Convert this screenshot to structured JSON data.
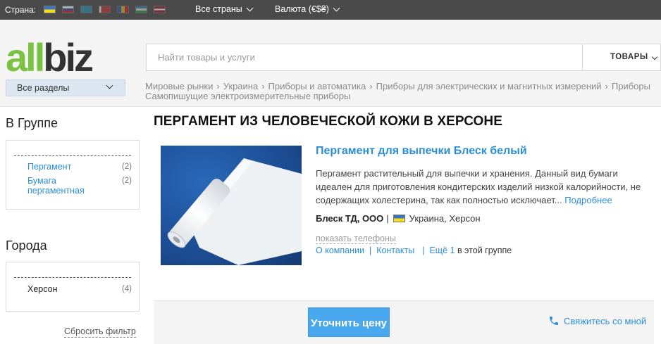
{
  "topbar": {
    "country_label": "Страна:",
    "flags": [
      "ukraine-flag-icon",
      "russia-flag-icon",
      "kazakhstan-flag-icon",
      "belarus-flag-icon",
      "moldova-flag-icon",
      "uzbekistan-flag-icon",
      "latvia-flag-icon"
    ],
    "all_countries": "Все страны",
    "currency": "Валюта (€$₴)"
  },
  "header": {
    "logo_part1": "all",
    "logo_part2": "biz",
    "sections_label": "Все разделы",
    "search_placeholder": "Найти товары и услуги",
    "search_type": "ТОВАРЫ",
    "breadcrumbs": [
      "Мировые рынки",
      "Украина",
      "Приборы и автоматика",
      "Приборы для электрических и магнитных измерений",
      "Приборы"
    ],
    "breadcrumb_last": "Самопишущие электроизмерительные приборы"
  },
  "sidebar": {
    "group_title": "В Группе",
    "group_items": [
      {
        "label": "Пергамент",
        "count": "(2)"
      },
      {
        "label": "Бумага пергаментная",
        "count": "(2)"
      }
    ],
    "cities_title": "Города",
    "city_items": [
      {
        "label": "Херсон",
        "count": "(4)"
      }
    ],
    "reset_label": "Сбросить фильтр"
  },
  "main": {
    "page_title": "ПЕРГАМЕНТ ИЗ ЧЕЛОВЕЧЕСКОЙ КОЖИ В ХЕРСОНЕ",
    "product": {
      "name": "Пергамент для выпечки Блеск белый",
      "description": "Пергамент растительный для выпечки и хранения. Данный вид бумаги идеален для приготовления кондитерских изделий низкой калорийности, не содержащих холестерина, так как полностью исключает...",
      "more": "Подробнее",
      "company": "Блеск ТД, ООО",
      "location": "Украина, Херсон",
      "show_phones": "показать телефоны",
      "about_company": "О компании",
      "contacts": "Контакты",
      "more_in_group": "Ещё 1",
      "in_group_suffix": "в этой группе"
    },
    "price_button": "Уточнить цену",
    "contact_me": "Свяжитесь со мной"
  },
  "colors": {
    "accent_link": "#2b8ed9",
    "logo_green": "#7cc242",
    "button_blue": "#4aa8ef",
    "topbar_bg": "#4a4a4a"
  }
}
